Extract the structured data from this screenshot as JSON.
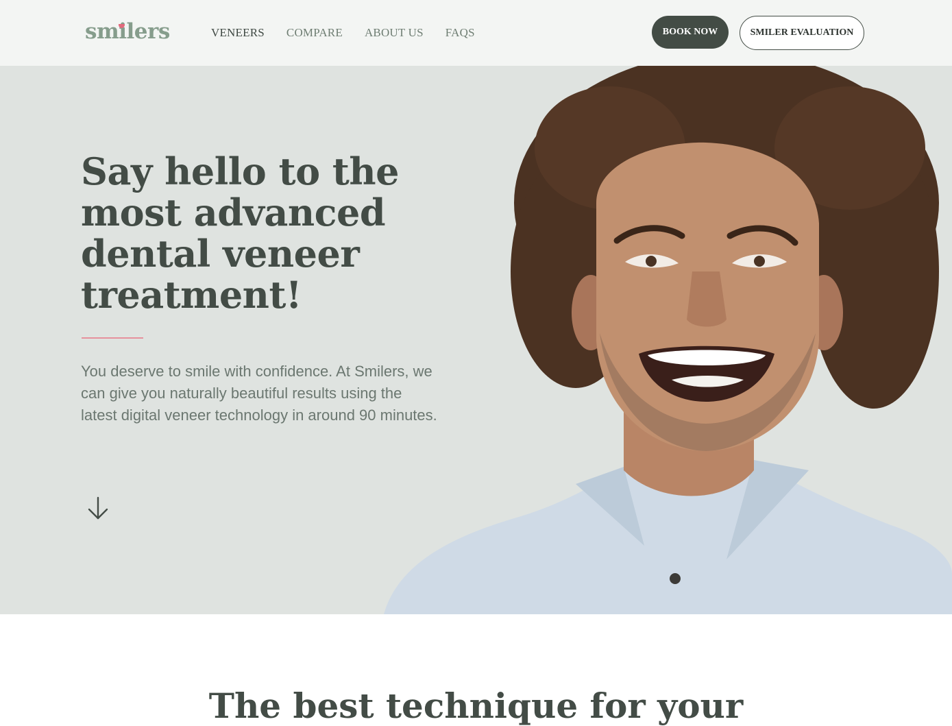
{
  "header": {
    "logo_text": "smilers",
    "nav": [
      {
        "label": "VENEERS",
        "active": true
      },
      {
        "label": "COMPARE",
        "active": false
      },
      {
        "label": "ABOUT US",
        "active": false
      },
      {
        "label": "FAQS",
        "active": false
      }
    ],
    "book_label": "BOOK NOW",
    "evaluation_label": "SMILER EVALUATION"
  },
  "hero": {
    "title": "Say hello to the most advanced dental veneer treatment!",
    "text": "You deserve to smile with confidence. At Smilers, we can give you naturally beautiful results using the latest digital veneer technology in around 90 minutes.",
    "scroll_icon": "arrow-down-icon"
  },
  "next_section": {
    "title": "The best technique for your"
  },
  "colors": {
    "brand_green": "#869d8c",
    "dark_green": "#434c45",
    "accent_pink": "#e26b7d",
    "hero_bg": "#dfe3e0"
  }
}
